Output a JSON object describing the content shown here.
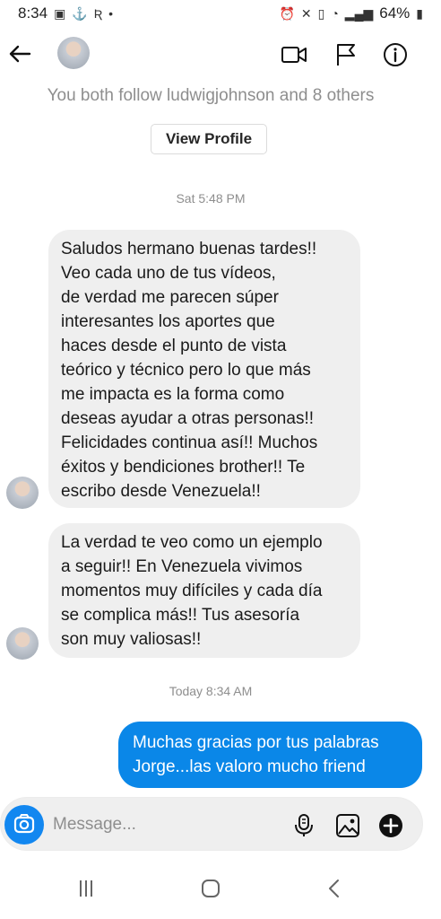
{
  "status_bar": {
    "time": "8:34",
    "battery": "64%",
    "left_icons": [
      "gallery-icon",
      "usb-icon",
      "r-app-icon",
      "dot-icon"
    ],
    "right_icons": [
      "alarm-icon",
      "mute-icon",
      "vibrate-icon",
      "wifi-icon",
      "signal-icon",
      "battery-icon"
    ]
  },
  "header": {
    "icons": [
      "back-arrow-icon",
      "avatar",
      "video-call-icon",
      "flag-icon",
      "info-icon"
    ]
  },
  "profile_note": {
    "follow_text": "You both follow ludwigjohnson and 8 others",
    "view_profile_label": "View Profile"
  },
  "conversation": {
    "timestamp_1": "Sat 5:48 PM",
    "message_1": "Saludos hermano buenas tardes!!\nVeo cada uno de tus vídeos,\nde verdad me parecen súper\ninteresantes los aportes que\nhaces desde el punto de vista\nteórico y técnico pero lo que más\nme impacta es la forma como\ndeseas ayudar a otras personas!!\nFelicidades continua así!! Muchos\néxitos y bendiciones brother!! Te\nescribo desde Venezuela!!",
    "message_2": "La verdad te veo como un ejemplo\na seguir!! En Venezuela vivimos\nmomentos muy difíciles y cada día\nse complica más!! Tus asesoría\nson muy valiosas!!",
    "timestamp_2": "Today 8:34 AM",
    "message_3": "Muchas gracias por tus palabras\nJorge...las valoro mucho friend"
  },
  "composer": {
    "placeholder": "Message...",
    "icons": [
      "camera-icon",
      "microphone-icon",
      "gallery-icon",
      "plus-icon"
    ]
  },
  "nav": {
    "icons": [
      "recent-apps-icon",
      "home-icon",
      "back-icon"
    ]
  },
  "colors": {
    "accent_blue": "#0a87e8",
    "incoming_bubble": "#efefef",
    "secondary_text": "#8e8e8e"
  }
}
